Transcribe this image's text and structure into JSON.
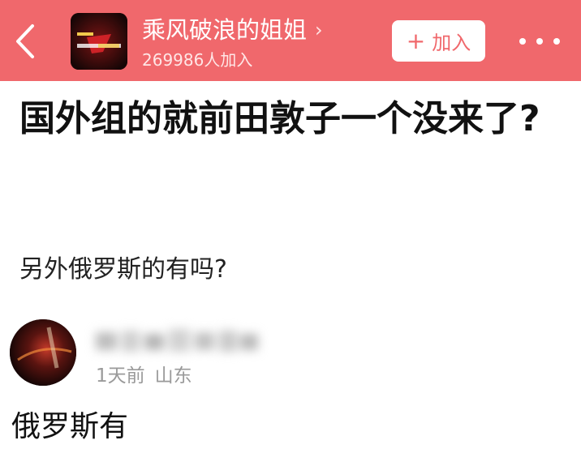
{
  "header": {
    "group_name": "乘风破浪的姐姐",
    "group_chevron": "›",
    "member_count": "269986人加入",
    "join_plus": "+",
    "join_label": "加入",
    "back_icon": "chevron-left-icon",
    "more_icon": "more-horizontal-icon",
    "bg_color": "#f0686c"
  },
  "post": {
    "title": "国外组的就前田敦子一个没来了?",
    "body": "另外俄罗斯的有吗?"
  },
  "comment": {
    "time": "1天前",
    "location": "山东",
    "text": "俄罗斯有"
  }
}
